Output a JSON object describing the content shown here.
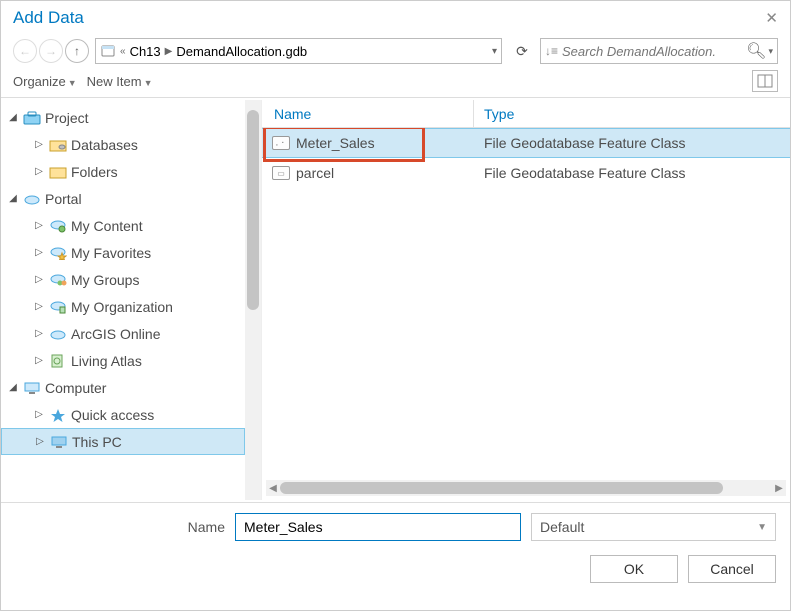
{
  "window": {
    "title": "Add Data"
  },
  "nav": {
    "back_enabled": false,
    "forward_enabled": false,
    "up_enabled": true
  },
  "breadcrumb": {
    "prefix": "«",
    "items": [
      "Ch13",
      "DemandAllocation.gdb"
    ]
  },
  "search": {
    "placeholder": "Search DemandAllocation."
  },
  "toolbar": {
    "organize": "Organize",
    "new_item": "New Item"
  },
  "tree": {
    "project": {
      "label": "Project",
      "expanded": true
    },
    "databases": {
      "label": "Databases"
    },
    "folders": {
      "label": "Folders"
    },
    "portal": {
      "label": "Portal",
      "expanded": true
    },
    "my_content": {
      "label": "My Content"
    },
    "my_favorites": {
      "label": "My Favorites"
    },
    "my_groups": {
      "label": "My Groups"
    },
    "my_organization": {
      "label": "My Organization"
    },
    "arcgis_online": {
      "label": "ArcGIS Online"
    },
    "living_atlas": {
      "label": "Living Atlas"
    },
    "computer": {
      "label": "Computer",
      "expanded": true
    },
    "quick_access": {
      "label": "Quick access"
    },
    "this_pc": {
      "label": "This PC",
      "selected": true
    }
  },
  "list": {
    "columns": {
      "name": "Name",
      "type": "Type"
    },
    "rows": [
      {
        "name": "Meter_Sales",
        "type": "File Geodatabase Feature Class",
        "selected": true,
        "highlighted": true
      },
      {
        "name": "parcel",
        "type": "File Geodatabase Feature Class",
        "selected": false
      }
    ],
    "selected_name": "Meter_Sales"
  },
  "footer": {
    "name_label": "Name",
    "name_value": "Meter_Sales",
    "filter_value": "Default",
    "ok": "OK",
    "cancel": "Cancel"
  }
}
